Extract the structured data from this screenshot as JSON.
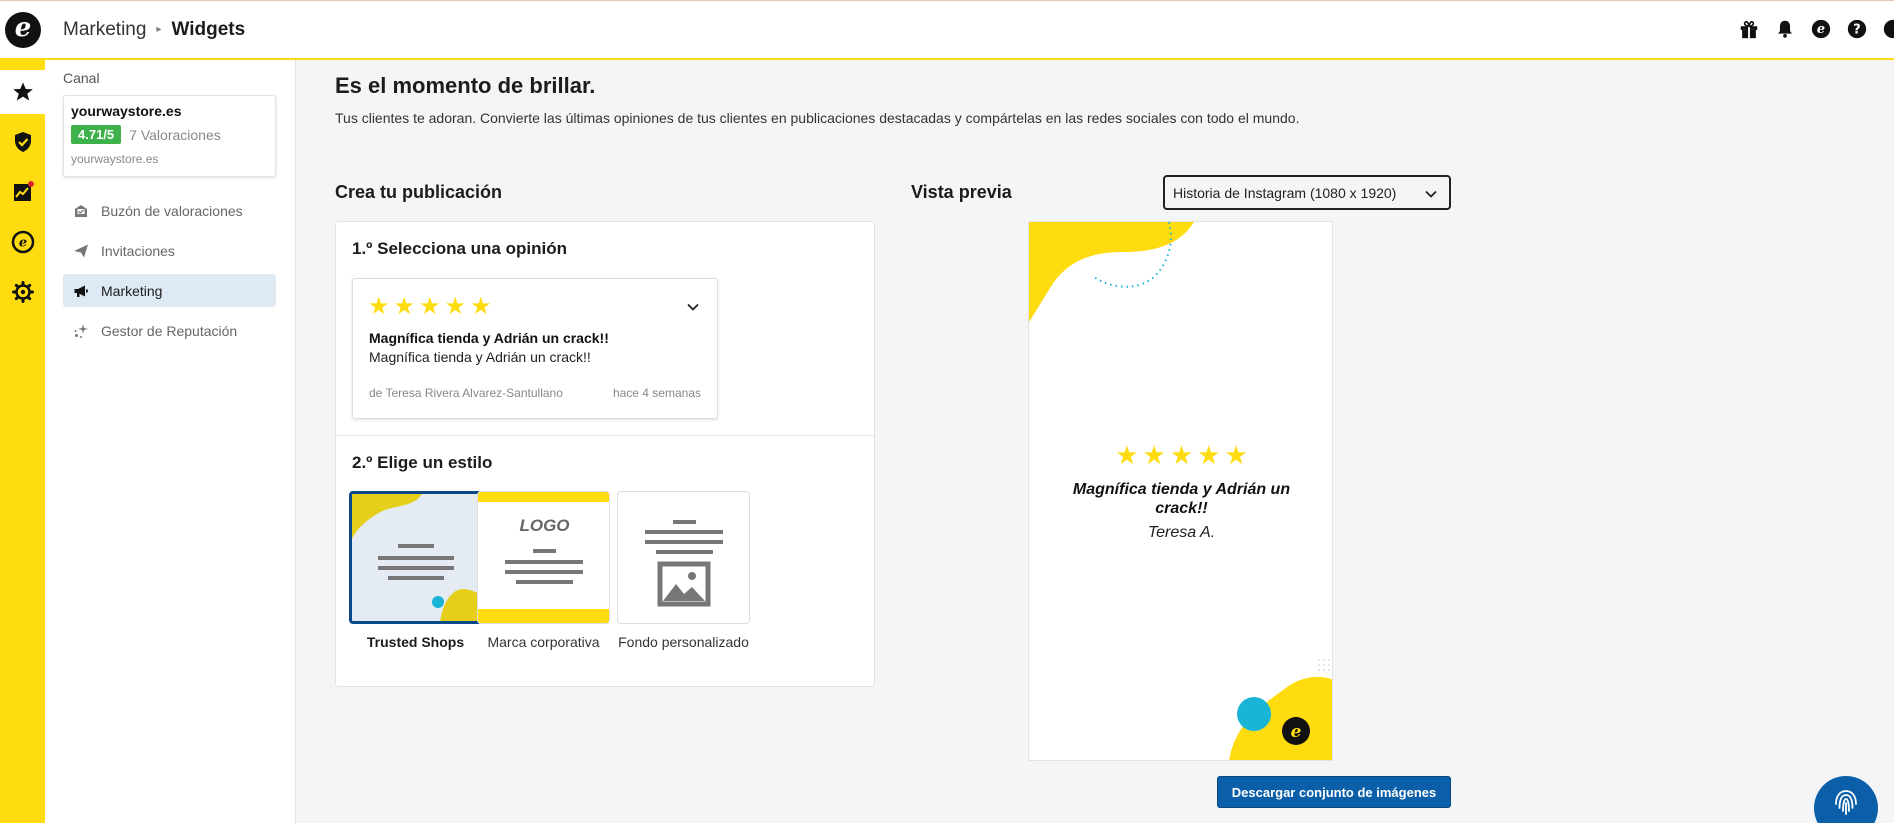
{
  "header": {
    "breadcrumb_parent": "Marketing",
    "breadcrumb_current": "Widgets",
    "icons": [
      "gift-icon",
      "bell-icon",
      "trusted-shops-e-icon",
      "help-icon",
      "user-avatar-icon"
    ]
  },
  "rail": {
    "items": [
      "star-icon",
      "shield-check-icon",
      "chart-icon",
      "trusted-shops-e-icon",
      "gear-icon"
    ],
    "active_index": 0
  },
  "sidebar": {
    "canal_label": "Canal",
    "shop_name": "yourwaystore.es",
    "rating": "4.71/5",
    "reviews_count": "7 Valoraciones",
    "domain": "yourwaystore.es",
    "nav": [
      {
        "label": "Buzón de valoraciones",
        "icon": "inbox-icon"
      },
      {
        "label": "Invitaciones",
        "icon": "send-icon"
      },
      {
        "label": "Marketing",
        "icon": "megaphone-icon",
        "active": true
      },
      {
        "label": "Gestor de Reputación",
        "icon": "sparkle-icon"
      }
    ]
  },
  "main": {
    "title": "Es el momento de brillar.",
    "subtitle": "Tus clientes te adoran. Convierte las últimas opiniones de tus clientes en publicaciones destacadas y compártelas en las redes sociales con todo el mundo.",
    "create_title": "Crea tu publicación",
    "step1_title": "1.º Selecciona una opinión",
    "review": {
      "stars": 5,
      "title": "Magnífica tienda y Adrián un crack!!",
      "text": "Magnífica tienda y Adrián un crack!!",
      "author": "de Teresa Rivera Alvarez-Santullano",
      "date": "hace 4 semanas"
    },
    "step2_title": "2.º Elige un estilo",
    "styles": [
      {
        "label": "Trusted Shops",
        "selected": true
      },
      {
        "label": "Marca corporativa",
        "logo_text": "LOGO"
      },
      {
        "label": "Fondo personalizado"
      }
    ]
  },
  "preview": {
    "title": "Vista previa",
    "format_selected": "Historia de Instagram (1080 x 1920)",
    "stars": 5,
    "review_title": "Magnífica tienda y Adrián un crack!!",
    "author": "Teresa A.",
    "download_label": "Descargar conjunto de imágenes"
  },
  "colors": {
    "brand_yellow": "#ffdc0f",
    "primary_blue": "#0a5fa8",
    "rating_green": "#3db24b",
    "accent_cyan": "#19b4d6"
  }
}
